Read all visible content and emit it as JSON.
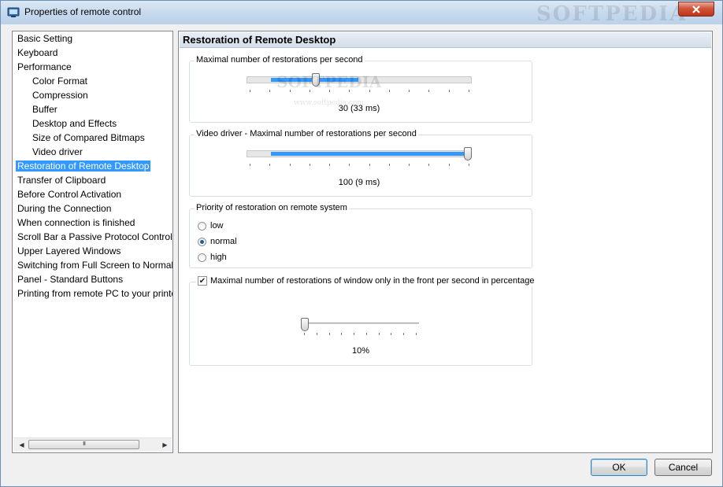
{
  "window": {
    "title": "Properties of remote control",
    "watermark": "SOFTPEDIA"
  },
  "tree": {
    "items": [
      {
        "label": "Basic Setting",
        "indent": 0
      },
      {
        "label": "Keyboard",
        "indent": 0
      },
      {
        "label": "Performance",
        "indent": 0
      },
      {
        "label": "Color Format",
        "indent": 1
      },
      {
        "label": "Compression",
        "indent": 1
      },
      {
        "label": "Buffer",
        "indent": 1
      },
      {
        "label": "Desktop and Effects",
        "indent": 1
      },
      {
        "label": "Size of Compared Bitmaps",
        "indent": 1
      },
      {
        "label": "Video driver",
        "indent": 1
      },
      {
        "label": "Restoration of Remote Desktop",
        "indent": 0,
        "selected": true
      },
      {
        "label": "Transfer of Clipboard",
        "indent": 0
      },
      {
        "label": "Before Control Activation",
        "indent": 0
      },
      {
        "label": "During the Connection",
        "indent": 0
      },
      {
        "label": "When connection is finished",
        "indent": 0
      },
      {
        "label": "Scroll Bar a Passive Protocol Control",
        "indent": 0
      },
      {
        "label": "Upper Layered Windows",
        "indent": 0
      },
      {
        "label": "Switching from Full Screen to Normal",
        "indent": 0
      },
      {
        "label": "Panel - Standard Buttons",
        "indent": 0
      },
      {
        "label": "Printing from remote PC to your printer",
        "indent": 0
      }
    ],
    "scroll_grip": "III"
  },
  "panel": {
    "title": "Restoration of Remote Desktop",
    "max_restorations": {
      "legend": "Maximal number of restorations per second",
      "value_text": "30 (33 ms)",
      "level": 0.3
    },
    "video_driver": {
      "legend": "Video driver - Maximal number of restorations per second",
      "value_text": "100 (9 ms)",
      "level": 1.0
    },
    "priority": {
      "legend": "Priority of restoration on remote system",
      "options": [
        "low",
        "normal",
        "high"
      ],
      "selected": "normal"
    },
    "window_front": {
      "checkbox_label": "Maximal number of restorations of window only in the front per second in percentage",
      "checked": true,
      "value_text": "10%",
      "level": 0.0
    },
    "watermark_text": "SOFTPEDIA",
    "watermark_url": "www.softpedia.com"
  },
  "buttons": {
    "ok": "OK",
    "cancel": "Cancel"
  },
  "colors": {
    "selection": "#3399ff",
    "slider_fill": "#3399ff"
  }
}
